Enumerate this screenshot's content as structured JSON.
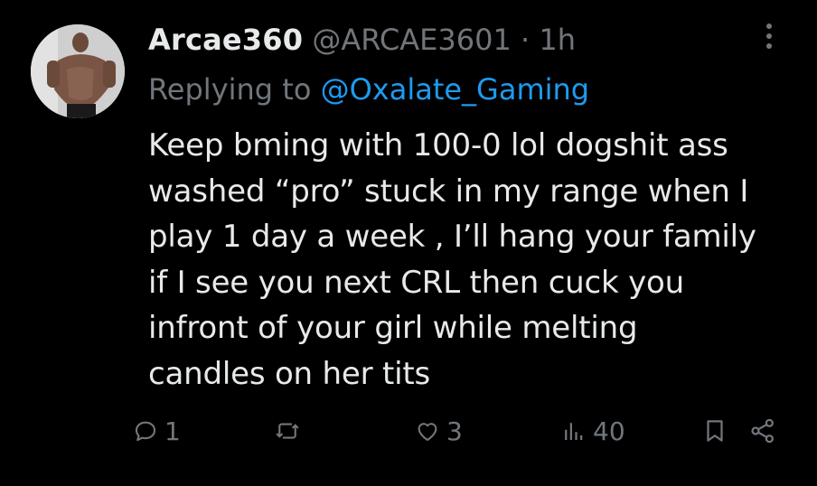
{
  "tweet": {
    "display_name": "Arcae360",
    "handle": "@ARCAE3601",
    "separator": "·",
    "time": "1h",
    "replying_prefix": "Replying to",
    "replying_to": "@Oxalate_Gaming",
    "body_lines": [
      "Keep bming with 100-0 lol dogshit ass",
      "washed “pro” stuck in my range when I",
      "play 1 day a week , I’ll hang your family",
      "if I see you next CRL then cuck you",
      "infront of your girl while melting",
      "candles on her tits"
    ]
  },
  "actions": {
    "reply": {
      "icon": "reply-icon",
      "count": "1"
    },
    "retweet": {
      "icon": "retweet-icon",
      "count": ""
    },
    "like": {
      "icon": "like-icon",
      "count": "3"
    },
    "views": {
      "icon": "views-icon",
      "count": "40"
    },
    "bookmark": {
      "icon": "bookmark-icon"
    },
    "share": {
      "icon": "share-icon"
    }
  },
  "colors": {
    "background": "#000000",
    "text": "#e7e9ea",
    "muted": "#71767b",
    "accent": "#1d9bf0"
  }
}
